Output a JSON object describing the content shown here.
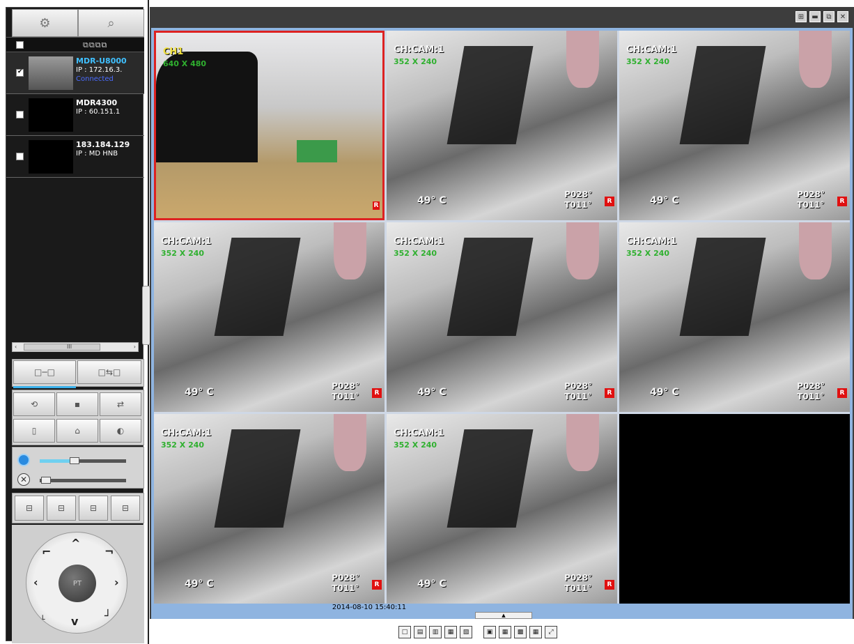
{
  "sidebar": {
    "device_header_icons": "⧉⧉⧉⧉",
    "devices": [
      {
        "name": "MDR-U8000",
        "ip": "IP : 172.16.3.",
        "status": "Connected",
        "checked": true
      },
      {
        "name": "MDR4300",
        "ip": "IP : 60.151.1",
        "status": "",
        "checked": false
      },
      {
        "name": "183.184.129",
        "ip": "IP : MD HNB",
        "status": "",
        "checked": false
      }
    ],
    "scroll_label": "III",
    "connect_buttons": [
      "□─□",
      "□⇆□"
    ],
    "action_buttons": [
      "⟲",
      "▪",
      "⇄",
      "▯",
      "⌂",
      "◐"
    ],
    "ptz_buttons": [
      "⊟",
      "⊟",
      "⊟",
      "⊟"
    ],
    "ptz_center_label": "PT",
    "sliders": {
      "volume_level": 0.4,
      "brightness_level": 0.05
    }
  },
  "viewer": {
    "window_controls": [
      "⊞",
      "▬",
      "⧉",
      "✕"
    ],
    "channels": [
      {
        "title": "CH1",
        "resolution": "640 X 480",
        "temp": "",
        "position": "",
        "rec": "R",
        "main": true
      },
      {
        "title": "CH:CAM:1",
        "resolution": "352 X 240",
        "temp": "49° C",
        "position": "P028°\nT011°",
        "rec": "R",
        "main": false
      },
      {
        "title": "CH:CAM:1",
        "resolution": "352 X 240",
        "temp": "49° C",
        "position": "P028°\nT011°",
        "rec": "R",
        "main": false
      },
      {
        "title": "CH:CAM:1",
        "resolution": "352 X 240",
        "temp": "49° C",
        "position": "P028°\nT011°",
        "rec": "R",
        "main": false
      },
      {
        "title": "CH:CAM:1",
        "resolution": "352 X 240",
        "temp": "49° C",
        "position": "P028°\nT011°",
        "rec": "R",
        "main": false
      },
      {
        "title": "CH:CAM:1",
        "resolution": "352 X 240",
        "temp": "49° C",
        "position": "P028°\nT011°",
        "rec": "R",
        "main": false
      },
      {
        "title": "CH:CAM:1",
        "resolution": "352 X 240",
        "temp": "49° C",
        "position": "P028°\nT011°",
        "rec": "R",
        "main": false
      },
      {
        "title": "CH:CAM:1",
        "resolution": "352 X 240",
        "temp": "49° C",
        "position": "P028°\nT011°",
        "rec": "R",
        "main": false
      },
      {
        "empty": true
      }
    ],
    "timestamp": "2014-08-10 15:40:11",
    "layout_buttons": [
      "□",
      "▤",
      "▥",
      "▦",
      "▧",
      "▣",
      "▦",
      "▩",
      "▦",
      "⤢"
    ]
  },
  "colors": {
    "accent_blue": "#8fb4e0",
    "record_red": "#e01010",
    "resolution_green": "#2fb02f"
  }
}
